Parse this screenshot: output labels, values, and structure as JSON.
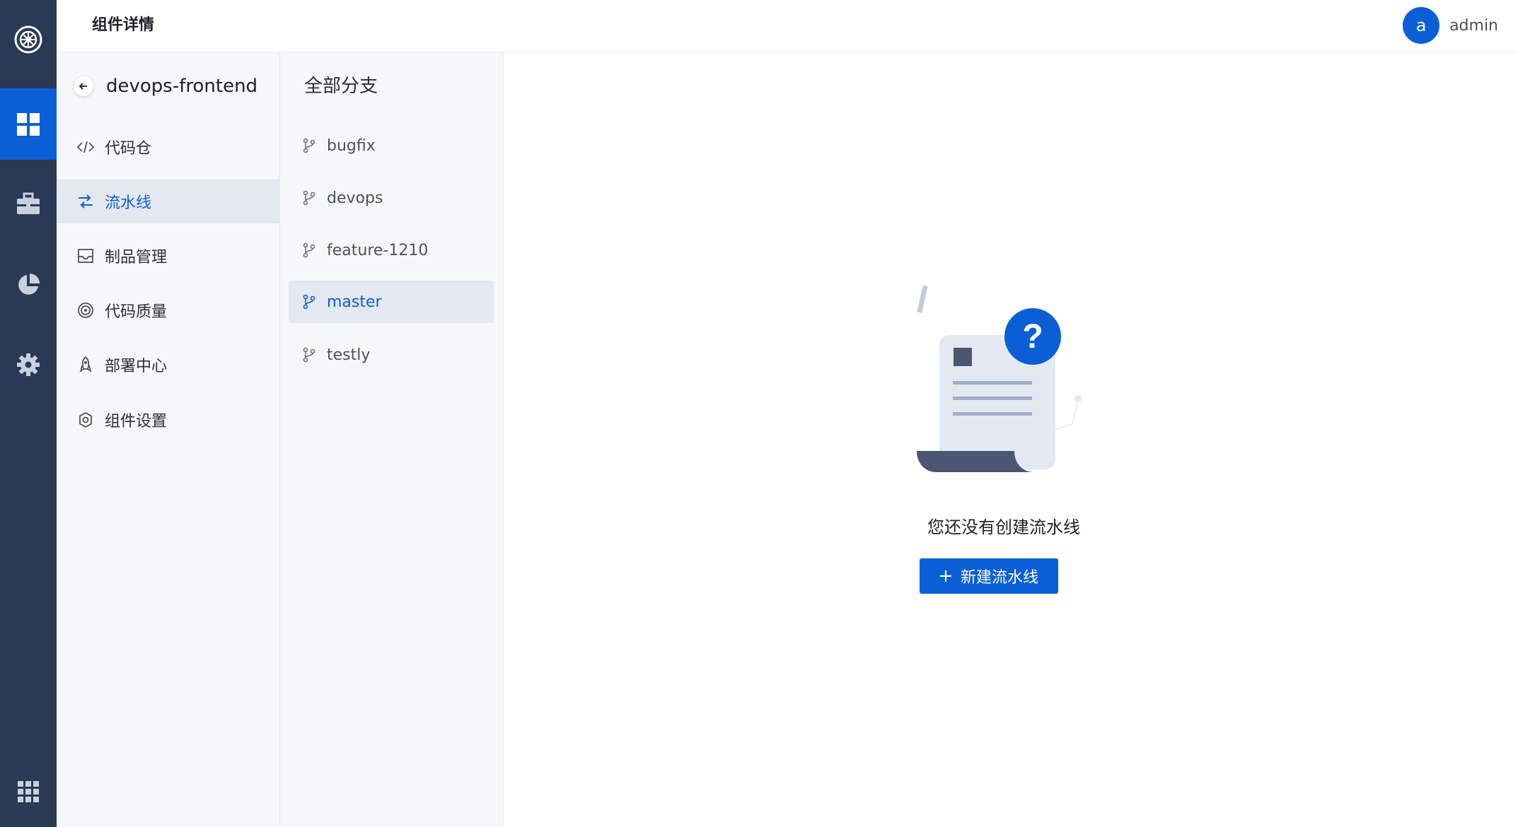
{
  "header": {
    "title": "组件详情"
  },
  "user": {
    "avatar_letter": "a",
    "name": "admin"
  },
  "rail": {
    "items": [
      {
        "icon": "dashboard-icon",
        "active": true
      },
      {
        "icon": "briefcase-icon",
        "active": false
      },
      {
        "icon": "pie-chart-icon",
        "active": false
      },
      {
        "icon": "gear-icon",
        "active": false
      }
    ],
    "bottom_icon": "apps-grid-icon"
  },
  "project": {
    "name": "devops-frontend"
  },
  "menu": {
    "items": [
      {
        "label": "代码仓",
        "icon": "code-icon",
        "active": false
      },
      {
        "label": "流水线",
        "icon": "pipeline-icon",
        "active": true
      },
      {
        "label": "制品管理",
        "icon": "inbox-icon",
        "active": false
      },
      {
        "label": "代码质量",
        "icon": "target-icon",
        "active": false
      },
      {
        "label": "部署中心",
        "icon": "rocket-icon",
        "active": false
      },
      {
        "label": "组件设置",
        "icon": "settings-icon",
        "active": false
      }
    ]
  },
  "branches": {
    "header": "全部分支",
    "items": [
      {
        "label": "bugfix",
        "active": false
      },
      {
        "label": "devops",
        "active": false
      },
      {
        "label": "feature-1210",
        "active": false
      },
      {
        "label": "master",
        "active": true
      },
      {
        "label": "testly",
        "active": false
      }
    ]
  },
  "empty_state": {
    "message": "您还没有创建流水线",
    "button_label": "新建流水线",
    "button_icon": "plus-icon"
  },
  "colors": {
    "rail_bg": "#2a3954",
    "accent": "#0b5fd6",
    "active_item_bg": "#e3e8f1"
  }
}
